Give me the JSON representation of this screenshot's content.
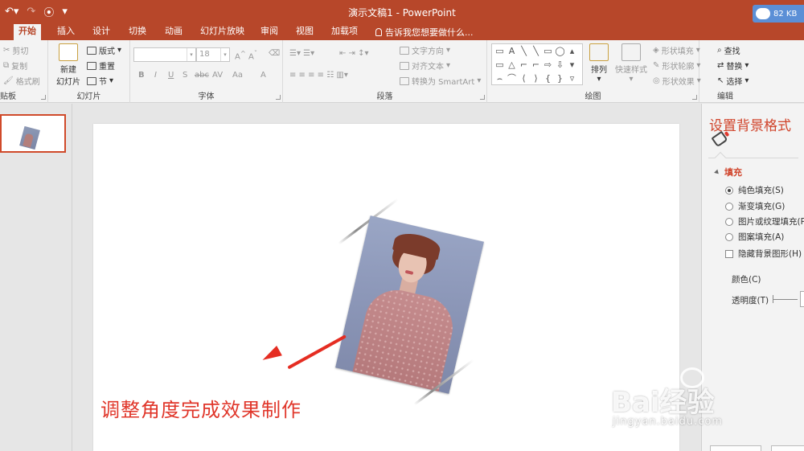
{
  "app": {
    "window_title": "演示文稿1 - PowerPoint",
    "quick_access": [
      "undo-icon",
      "redo-icon",
      "present-icon",
      "customize-icon"
    ],
    "badge": {
      "text": "82 KB",
      "icon": "cloud-icon"
    }
  },
  "tabs": [
    {
      "label": "开始",
      "active": true
    },
    {
      "label": "插入"
    },
    {
      "label": "设计"
    },
    {
      "label": "切换"
    },
    {
      "label": "动画"
    },
    {
      "label": "幻灯片放映"
    },
    {
      "label": "审阅"
    },
    {
      "label": "视图"
    },
    {
      "label": "加载项"
    }
  ],
  "tell_me": "告诉我您想要做什么...",
  "ribbon": {
    "clipboard": {
      "label": "贴板",
      "cut": "剪切",
      "copy": "复制",
      "format_painter": "格式刷"
    },
    "slides": {
      "label": "幻灯片",
      "new_slide_line1": "新建",
      "new_slide_line2": "幻灯片",
      "layout": "版式",
      "reset": "重置",
      "section": "节"
    },
    "font": {
      "label": "字体",
      "font_name": "",
      "font_size": "18",
      "styles": [
        "B",
        "I",
        "U",
        "S",
        "abc",
        "AV",
        "Aa",
        "A"
      ]
    },
    "paragraph": {
      "label": "段落",
      "text_direction": "文字方向",
      "align_text": "对齐文本",
      "smartart": "转换为 SmartArt"
    },
    "drawing": {
      "label": "绘图",
      "arrange": "排列",
      "quick_styles": "快速样式",
      "shape_fill": "形状填充",
      "shape_outline": "形状轮廓",
      "shape_effects": "形状效果",
      "shapes": [
        "▭",
        "A",
        "╲",
        "╲",
        "▭",
        "◯",
        "▭",
        "△",
        "⌐",
        "⌐",
        "⇨",
        "⇩",
        "⌢",
        "⌒",
        "⟨",
        "⟩",
        "{",
        "}"
      ]
    },
    "editing": {
      "label": "编辑",
      "find": "查找",
      "replace": "替换",
      "select": "选择"
    }
  },
  "slide": {
    "caption": "调整角度完成效果制作",
    "photo_description_icon": "portrait-photo"
  },
  "format_panel": {
    "title": "设置背景格式",
    "section": "填充",
    "options": [
      {
        "label": "纯色填充(S)",
        "selected": true
      },
      {
        "label": "渐变填充(G)",
        "selected": false
      },
      {
        "label": "图片或纹理填充(P)",
        "selected": false
      },
      {
        "label": "图案填充(A)",
        "selected": false
      }
    ],
    "hide_background": "隐藏背景图形(H)",
    "color_label": "颜色(C)",
    "transparency_label": "透明度(T)"
  },
  "watermark": {
    "logo": "Bai经验",
    "url": "jingyan.baidu.com"
  },
  "colors": {
    "accent": "#b7472a",
    "annotation": "#e0362a",
    "ribbon_bg": "#f3f3f3"
  }
}
